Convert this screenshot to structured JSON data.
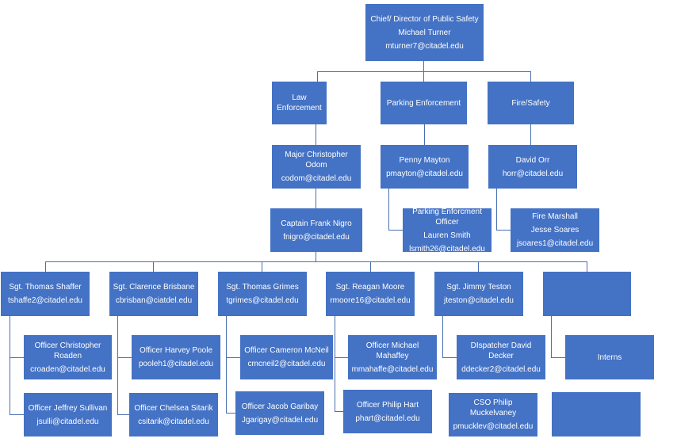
{
  "nodes": [
    {
      "id": "chief",
      "lines": [
        "Chief/ Director of Public Safety",
        "Michael Turner",
        "mturner7@citadel.edu"
      ]
    },
    {
      "id": "law",
      "lines": [
        "Law Enforcement"
      ]
    },
    {
      "id": "parking",
      "lines": [
        "Parking Enforcement"
      ]
    },
    {
      "id": "fire",
      "lines": [
        "Fire/Safety"
      ]
    },
    {
      "id": "major",
      "lines": [
        "Major Christopher Odom",
        "codom@citadel.edu"
      ]
    },
    {
      "id": "penny",
      "lines": [
        "Penny Mayton",
        "pmayton@citadel.edu"
      ]
    },
    {
      "id": "orr",
      "lines": [
        "David Orr",
        "horr@citadel.edu"
      ]
    },
    {
      "id": "captain",
      "lines": [
        "Captain Frank Nigro",
        "fnigro@citadel.edu"
      ]
    },
    {
      "id": "pofficer",
      "lines": [
        "Parking Enforcment Officer",
        "Lauren Smith",
        "lsmith26@citadel.edu"
      ]
    },
    {
      "id": "marshall",
      "lines": [
        "Fire Marshall",
        "Jesse Soares",
        "jsoares1@citadel.edu"
      ]
    },
    {
      "id": "shaffer",
      "lines": [
        "Sgt. Thomas Shaffer",
        "tshaffe2@citadel.edu"
      ]
    },
    {
      "id": "brisbane",
      "lines": [
        "Sgt. Clarence Brisbane",
        "cbrisban@ciatdel.edu"
      ]
    },
    {
      "id": "grimes",
      "lines": [
        "Sgt. Thomas Grimes",
        "tgrimes@citadel.edu"
      ]
    },
    {
      "id": "moore",
      "lines": [
        "Sgt. Reagan Moore",
        "rmoore16@citadel.edu"
      ]
    },
    {
      "id": "teston",
      "lines": [
        "Sgt. Jimmy Teston",
        "jteston@citadel.edu"
      ]
    },
    {
      "id": "blank1",
      "lines": []
    },
    {
      "id": "roaden",
      "lines": [
        "Officer Christopher Roaden",
        "croaden@citadel.edu"
      ]
    },
    {
      "id": "poole",
      "lines": [
        "Officer Harvey Poole",
        "pooleh1@citadel.edu"
      ]
    },
    {
      "id": "mcneil",
      "lines": [
        "Officer Cameron McNeil",
        "cmcneil2@citadel.edu"
      ]
    },
    {
      "id": "mahaffey",
      "lines": [
        "Officer Michael Mahaffey",
        "mmahaffe@citadel.edu"
      ]
    },
    {
      "id": "decker",
      "lines": [
        "DIspatcher David Decker",
        "ddecker2@citadel.edu"
      ]
    },
    {
      "id": "interns",
      "lines": [
        "Interns"
      ]
    },
    {
      "id": "sullivan",
      "lines": [
        "Officer Jeffrey Sullivan",
        "jsulli@citadel.edu"
      ]
    },
    {
      "id": "sitarik",
      "lines": [
        "Officer Chelsea Sitarik",
        "csitarik@citadel.edu"
      ]
    },
    {
      "id": "garibay",
      "lines": [
        "Officer Jacob Garibay",
        "Jgarigay@citadel.edu"
      ]
    },
    {
      "id": "hart",
      "lines": [
        "Officer Philip Hart",
        "phart@citadel.edu"
      ]
    },
    {
      "id": "muckelvaney",
      "lines": [
        "CSO Philip Muckelvaney",
        "pmucklev@citadel.edu"
      ]
    },
    {
      "id": "blank2",
      "lines": []
    }
  ],
  "colors": {
    "box": "#4472c4",
    "connector": "#4a6fb0",
    "text": "#ffffff"
  }
}
